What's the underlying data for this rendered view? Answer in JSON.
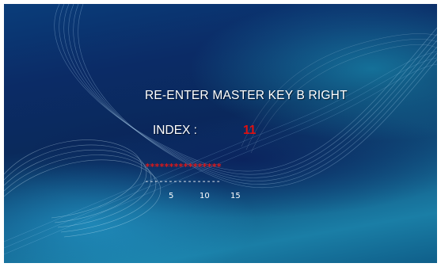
{
  "prompt": {
    "title": "RE-ENTER MASTER KEY B RIGHT",
    "index_label": "INDEX :",
    "index_value": "11"
  },
  "key_entry": {
    "masked_value": "****************",
    "underline": "----------------",
    "position_markers": [
      "5",
      "10",
      "15"
    ]
  },
  "colors": {
    "text": "#ffffff",
    "highlight": "#e01010",
    "background_dark": "#0a2a5c",
    "background_light": "#1a7ea6"
  }
}
